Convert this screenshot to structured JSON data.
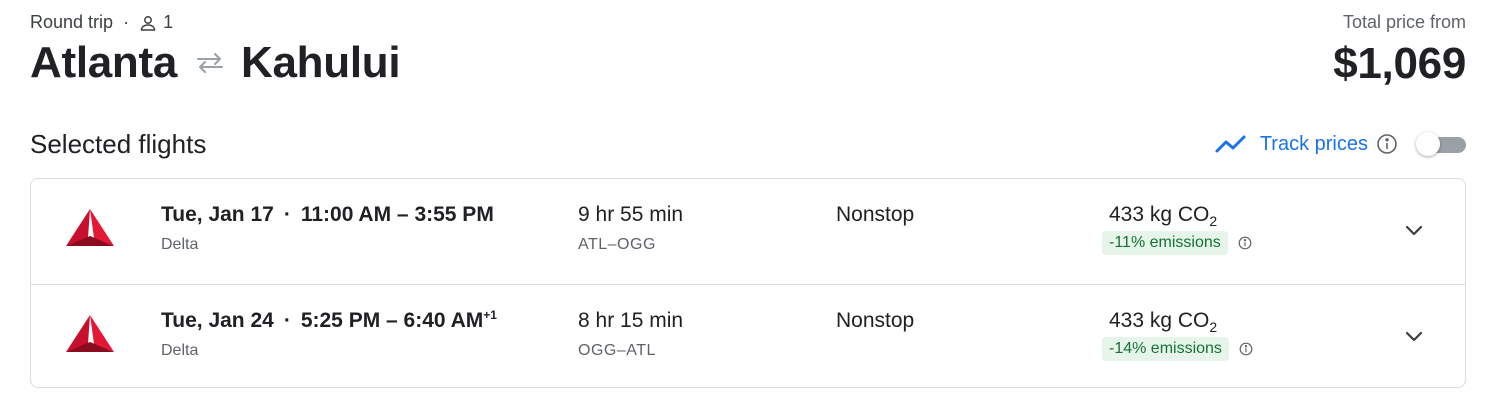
{
  "trip": {
    "type": "Round trip",
    "separator": "·",
    "passengers": "1",
    "origin": "Atlanta",
    "destination": "Kahului"
  },
  "price": {
    "label": "Total price from",
    "value": "$1,069"
  },
  "section": {
    "title": "Selected flights",
    "track_label": "Track prices",
    "track_enabled": false
  },
  "flights": [
    {
      "date": "Tue, Jan 17",
      "sep": "·",
      "times": "11:00 AM – 3:55 PM",
      "day_offset": "",
      "airline": "Delta",
      "duration": "9 hr 55 min",
      "airports": "ATL–OGG",
      "stops": "Nonstop",
      "co2_value": "433 kg CO",
      "co2_sub": "2",
      "emissions": "-11% emissions"
    },
    {
      "date": "Tue, Jan 24",
      "sep": "·",
      "times": "5:25 PM – 6:40 AM",
      "day_offset": "+1",
      "airline": "Delta",
      "duration": "8 hr 15 min",
      "airports": "OGG–ATL",
      "stops": "Nonstop",
      "co2_value": "433 kg CO",
      "co2_sub": "2",
      "emissions": "-14% emissions"
    }
  ],
  "icons": {
    "person": "person-icon",
    "swap": "swap-arrows-icon",
    "trend": "trending-icon",
    "info": "info-icon",
    "chevron": "chevron-down-icon",
    "airline_logo": "delta-logo"
  },
  "colors": {
    "accent": "#1a73e8",
    "delta_red": "#c8102e",
    "emission_bg": "#e6f4ea",
    "emission_text": "#137333"
  }
}
